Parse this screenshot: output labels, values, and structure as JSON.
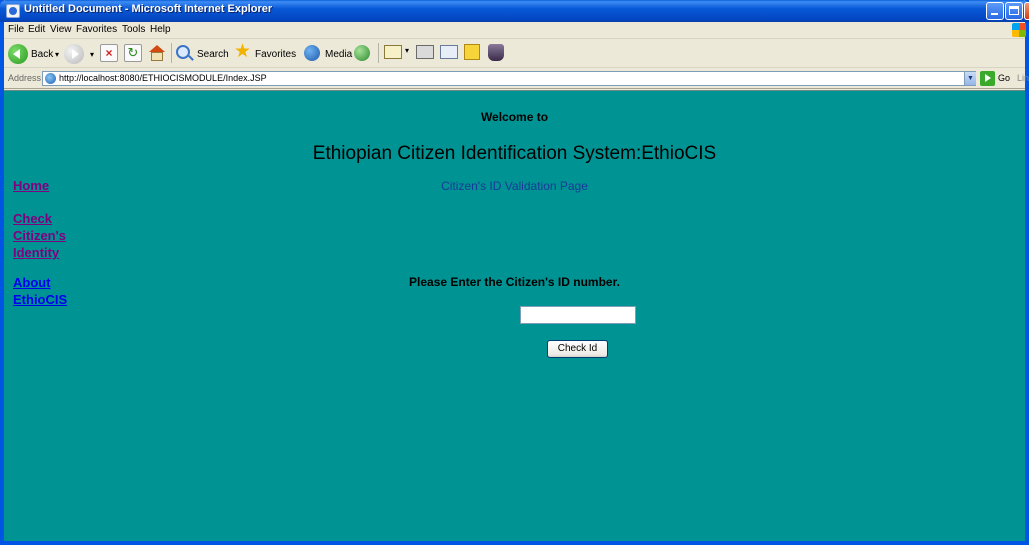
{
  "window": {
    "title": "Untitled Document - Microsoft Internet Explorer"
  },
  "menubar": {
    "items": [
      "File",
      "Edit",
      "View",
      "Favorites",
      "Tools",
      "Help"
    ]
  },
  "toolbar": {
    "back_label": "Back",
    "search_label": "Search",
    "favorites_label": "Favorites",
    "media_label": "Media"
  },
  "addressbar": {
    "label": "Address",
    "url": "http://localhost:8080/ETHIOCISMODULE/Index.JSP",
    "go_label": "Go",
    "links_label": "Links"
  },
  "page": {
    "welcome": "Welcome to",
    "title": "Ethiopian Citizen Identification System:EthioCIS",
    "subtitle": "Citizen's ID Validation Page",
    "prompt": "Please Enter the Citizen's ID number.",
    "id_input_value": "",
    "check_button_label": "Check Id"
  },
  "sidebar": {
    "home": "Home",
    "check_line1": "Check",
    "check_line2": "Citizen's",
    "check_line3": "Identity",
    "about_line1": "About",
    "about_line2": "EthioCIS"
  },
  "colors": {
    "page_background": "#009393",
    "visited_link": "#800080",
    "link": "#0000ee",
    "subtitle": "#1a3a9a"
  }
}
